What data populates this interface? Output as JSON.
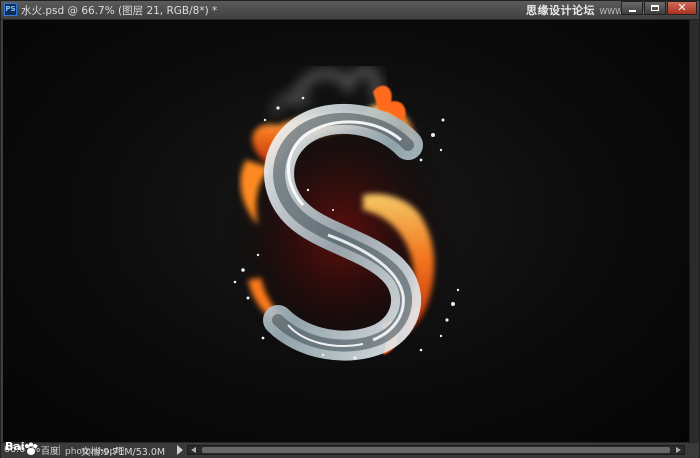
{
  "window": {
    "title": "水火.psd @ 66.7% (图层 21, RGB/8*) *",
    "app_icon": "PS"
  },
  "watermark": {
    "text": "思缘设计论坛",
    "url": "WWW.MISSYUAN.COM"
  },
  "window_buttons": {
    "minimize_icon": "minimize-icon",
    "maximize_icon": "maximize-icon",
    "close_icon": "close-icon",
    "close_glyph": "✕"
  },
  "status": {
    "zoom": "66.67%",
    "baidu_logo": "Bai",
    "baidu_suffix": "百度",
    "doc_info": "文档:9.71M/53.0M",
    "overlay_text": "photo.shop吧"
  },
  "colors": {
    "canvas_bg": "#0b0b0b",
    "fire": "#ff6a1a",
    "water": "#d9e4ea",
    "chrome": "#3f3f3f"
  }
}
